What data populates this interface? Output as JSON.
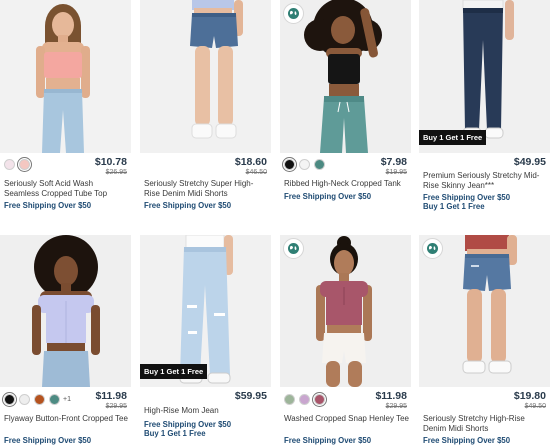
{
  "products": [
    {
      "name": "Seriously Soft Acid Wash Seamless Cropped Tube Top",
      "price": "$10.78",
      "was_price": "$26.95",
      "shipping": "Free Shipping Over $50",
      "swatches": [
        "#f3e3ea",
        "#f4c7c1"
      ],
      "eco_icon": false
    },
    {
      "name": "Seriously Stretchy Super High-Rise Denim Midi Shorts",
      "price": "$18.60",
      "was_price": "$46.50",
      "shipping": "Free Shipping Over $50",
      "swatches": [],
      "eco_icon": false
    },
    {
      "name": "Ribbed High-Neck Cropped Tank",
      "price": "$7.98",
      "was_price": "$19.95",
      "shipping": "Free Shipping Over $50",
      "swatches": [
        "#111111",
        "#f4f4f4",
        "#4c8a82"
      ],
      "eco_icon": true
    },
    {
      "name": "Premium Seriously Stretchy Mid-Rise Skinny Jean***",
      "price": "$49.95",
      "shipping": "Free Shipping Over $50",
      "promo": "Buy 1 Get 1 Free",
      "badge": "Buy 1 Get 1 Free",
      "swatches": [],
      "eco_icon": false
    },
    {
      "name": "Flyaway Button-Front Cropped Tee",
      "price": "$11.98",
      "was_price": "$29.95",
      "shipping": "Free Shipping Over $50",
      "swatches": [
        "#111111",
        "#eeeeee",
        "#b5531f",
        "#4d8b83"
      ],
      "more_colors": "+1",
      "eco_icon": false
    },
    {
      "name": "High-Rise Mom Jean",
      "price": "$59.95",
      "shipping": "Free Shipping Over $50",
      "promo": "Buy 1 Get 1 Free",
      "badge": "Buy 1 Get 1 Free",
      "swatches": [],
      "eco_icon": false
    },
    {
      "name": "Washed Cropped Snap Henley Tee",
      "price": "$11.98",
      "was_price": "$29.95",
      "shipping": "Free Shipping Over $50",
      "swatches": [
        "#9db59a",
        "#c9a6cf",
        "#a8556a"
      ],
      "eco_icon": true
    },
    {
      "name": "Seriously Stretchy High-Rise Denim Midi Shorts",
      "price": "$19.80",
      "was_price": "$49.50",
      "shipping": "Free Shipping Over $50",
      "swatches": [],
      "eco_icon": true
    }
  ],
  "colors": {
    "price": "#2a3b4c",
    "shipping": "#1f4b73",
    "photo_bg": "#efefef"
  }
}
